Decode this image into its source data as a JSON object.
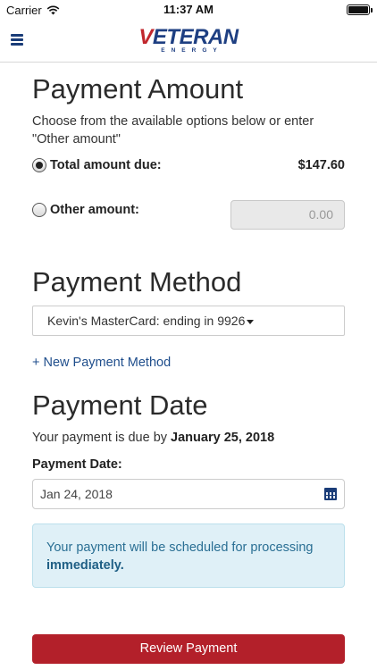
{
  "status_bar": {
    "carrier": "Carrier",
    "time": "11:37 AM",
    "wifi_icon": "wifi-icon",
    "battery_icon": "battery-icon"
  },
  "nav": {
    "menu_icon": "hamburger-menu-icon",
    "logo_main": "ETERAN",
    "logo_v": "V",
    "logo_sub": "ENERGY"
  },
  "payment_amount": {
    "title": "Payment Amount",
    "instructions": "Choose from the available options below or enter \"Other amount\"",
    "total_label": "Total amount due:",
    "total_value": "$147.60",
    "total_selected": true,
    "other_label": "Other amount:",
    "other_placeholder": "0.00"
  },
  "payment_method": {
    "title": "Payment Method",
    "selected": "Kevin's MasterCard: ending in 9926",
    "new_link": "+ New Payment Method"
  },
  "payment_date": {
    "title": "Payment Date",
    "due_prefix": "Your payment is due by ",
    "due_date": "January 25, 2018",
    "label": "Payment Date:",
    "value": "Jan 24, 2018",
    "calendar_icon": "calendar-icon"
  },
  "alert": {
    "text": "Your payment will be scheduled for processing ",
    "emphasis": "immediately."
  },
  "actions": {
    "review_label": "Review Payment"
  },
  "colors": {
    "brand_blue": "#1e3f82",
    "brand_red": "#c1272d",
    "button_red": "#b3202a",
    "alert_bg": "#dff0f7",
    "alert_text": "#2a6f94"
  }
}
